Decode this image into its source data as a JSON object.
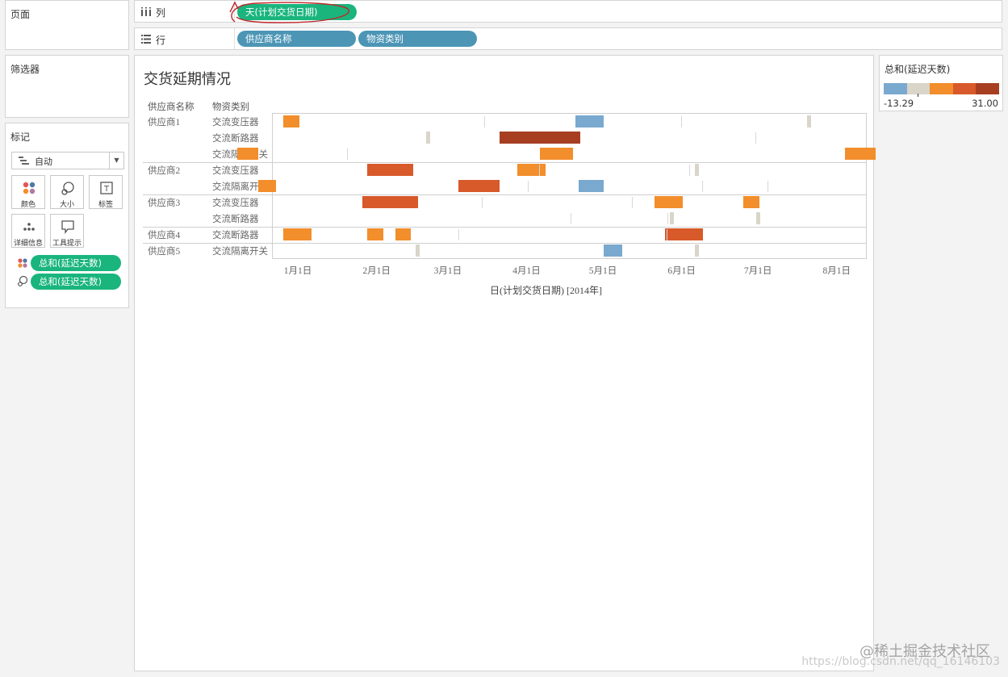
{
  "panels": {
    "pages_label": "页面",
    "filters_label": "筛选器",
    "marks_label": "标记",
    "marks_type": "自动",
    "mark_buttons": [
      {
        "label": "颜色",
        "icon": "color-dots-icon"
      },
      {
        "label": "大小",
        "icon": "size-icon"
      },
      {
        "label": "标签",
        "icon": "label-icon"
      },
      {
        "label": "详细信息",
        "icon": "detail-icon"
      },
      {
        "label": "工具提示",
        "icon": "tooltip-icon"
      }
    ],
    "mark_pills": [
      {
        "icon": "color-dots-icon",
        "label": "总和(延迟天数)"
      },
      {
        "icon": "size-icon",
        "label": "总和(延迟天数)"
      }
    ]
  },
  "shelves": {
    "columns_label": "列",
    "rows_label": "行",
    "columns_pills": [
      "天(计划交货日期)"
    ],
    "rows_pills": [
      "供应商名称",
      "物资类别"
    ]
  },
  "legend": {
    "title": "总和(延迟天数)",
    "min_label": "-13.29",
    "max_label": "31.00",
    "colors": [
      "#79a9cf",
      "#d9d5c9",
      "#f28e2b",
      "#d8592a",
      "#a73e22"
    ]
  },
  "colors": {
    "accent_green": "#19b57d",
    "accent_blue": "#4c95b5",
    "annotation_red": "#c0282d"
  },
  "watermark": {
    "line1": "@稀土掘金技术社区",
    "line2": "https://blog.csdn.net/qq_16146103"
  },
  "chart_data": {
    "type": "gantt",
    "title": "交货延期情况",
    "column_headers": [
      "供应商名称",
      "物资类别"
    ],
    "xlabel": "日(计划交货日期) [2014年]",
    "x_ticks": [
      "1月1日",
      "2月1日",
      "3月1日",
      "4月1日",
      "5月1日",
      "6月1日",
      "7月1日",
      "8月1日"
    ],
    "color_measure": "总和(延迟天数)",
    "color_range": [
      -13.29,
      31.0
    ],
    "groups": [
      {
        "supplier": "供应商1",
        "rows": [
          {
            "category": "交流变压器",
            "bars": [
              {
                "start": "2013-12-26",
                "delay": 5
              },
              {
                "start": "2014-04-20",
                "delay": -10
              },
              {
                "start": "2014-07-20",
                "delay": 0
              }
            ]
          },
          {
            "category": "交流断路器",
            "bars": [
              {
                "start": "2014-02-20",
                "delay": 0
              },
              {
                "start": "2014-03-21",
                "delay": 31
              }
            ]
          },
          {
            "category": "交流隔离开关",
            "bars": [
              {
                "start": "2013-12-08",
                "delay": 7
              },
              {
                "start": "2014-04-06",
                "delay": 12
              },
              {
                "start": "2014-08-04",
                "delay": 11
              }
            ]
          }
        ]
      },
      {
        "supplier": "供应商2",
        "rows": [
          {
            "category": "交流变压器",
            "bars": [
              {
                "start": "2014-01-28",
                "delay": 17
              },
              {
                "start": "2014-03-28",
                "delay": 10
              },
              {
                "start": "2014-06-06",
                "delay": 0
              }
            ]
          },
          {
            "category": "交流隔离开关",
            "bars": [
              {
                "start": "2013-12-16",
                "delay": 6
              },
              {
                "start": "2014-03-05",
                "delay": 15
              },
              {
                "start": "2014-04-21",
                "delay": -9
              }
            ]
          }
        ]
      },
      {
        "supplier": "供应商3",
        "rows": [
          {
            "category": "交流变压器",
            "bars": [
              {
                "start": "2014-01-26",
                "delay": 21
              },
              {
                "start": "2014-05-21",
                "delay": 10
              },
              {
                "start": "2014-06-25",
                "delay": 5
              }
            ]
          },
          {
            "category": "交流断路器",
            "bars": [
              {
                "start": "2014-05-27",
                "delay": 0
              },
              {
                "start": "2014-06-30",
                "delay": 0
              }
            ]
          }
        ]
      },
      {
        "supplier": "供应商4",
        "rows": [
          {
            "category": "交流断路器",
            "bars": [
              {
                "start": "2013-12-26",
                "delay": 10
              },
              {
                "start": "2014-01-28",
                "delay": 5
              },
              {
                "start": "2014-02-08",
                "delay": 5
              },
              {
                "start": "2014-05-25",
                "delay": 14
              }
            ]
          }
        ]
      },
      {
        "supplier": "供应商5",
        "rows": [
          {
            "category": "交流隔离开关",
            "bars": [
              {
                "start": "2014-02-16",
                "delay": 0
              },
              {
                "start": "2014-05-01",
                "delay": -6
              },
              {
                "start": "2014-06-06",
                "delay": 0
              }
            ]
          }
        ]
      }
    ]
  }
}
